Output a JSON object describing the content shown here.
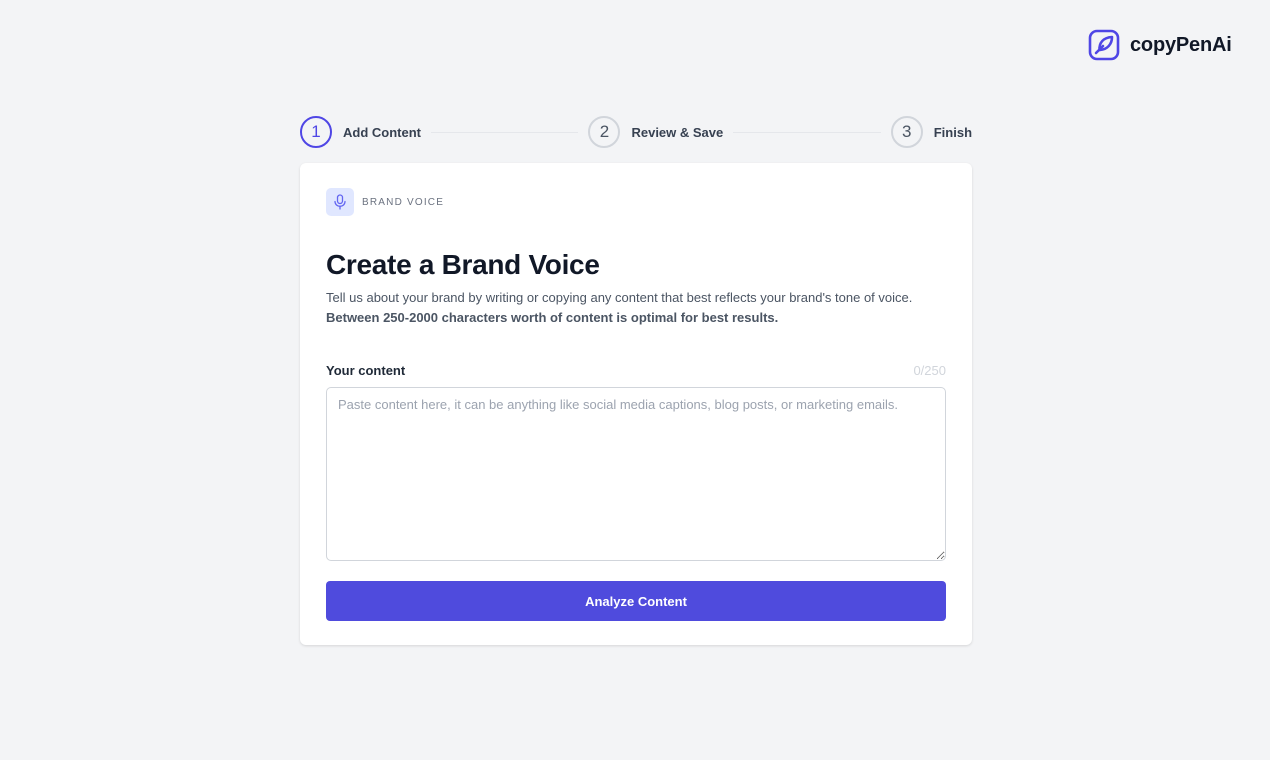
{
  "brand": {
    "name": "copyPenAi",
    "icon": "feather-icon",
    "accent": "#4f46e5"
  },
  "stepper": {
    "steps": [
      {
        "number": "1",
        "label": "Add Content",
        "state": "active"
      },
      {
        "number": "2",
        "label": "Review & Save",
        "state": "upcoming"
      },
      {
        "number": "3",
        "label": "Finish",
        "state": "upcoming"
      }
    ]
  },
  "card": {
    "section_tag": {
      "label": "BRAND VOICE",
      "icon": "microphone-icon"
    },
    "title": "Create a Brand Voice",
    "description_plain": "Tell us about your brand by writing or copying any content that best reflects your brand's tone of voice. ",
    "description_bold": "Between 250-2000 characters worth of content is optimal for best results.",
    "field": {
      "label": "Your content",
      "counter": "0/250",
      "value": "",
      "placeholder": "Paste content here, it can be anything like social media captions, blog posts, or marketing emails."
    },
    "button": {
      "label": "Analyze Content",
      "color": "#4f4bdd"
    }
  }
}
